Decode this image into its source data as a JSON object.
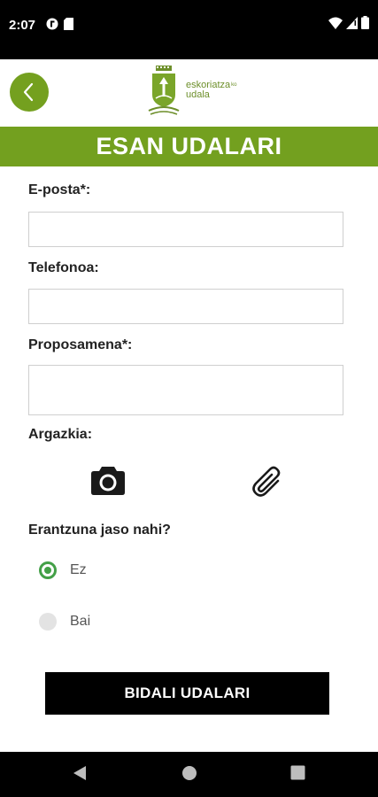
{
  "status_bar": {
    "time": "2:07",
    "icons": [
      "app-notification-icon",
      "sd-card-icon",
      "wifi-icon",
      "signal-icon",
      "battery-icon"
    ]
  },
  "header": {
    "logo_main": "eskoriatza",
    "logo_suffix": "ko",
    "logo_sub": "udala",
    "brand_color": "#73a01f"
  },
  "page": {
    "title": "ESAN UDALARI"
  },
  "form": {
    "email_label": "E-posta*:",
    "email_value": "",
    "phone_label": "Telefonoa:",
    "phone_value": "",
    "proposal_label": "Proposamena*:",
    "proposal_value": "",
    "photo_label": "Argazkia:",
    "photo_actions": [
      "camera-icon",
      "paperclip-icon"
    ],
    "answer_question": "Erantzuna jaso nahi?",
    "answer_options": [
      {
        "label": "Ez",
        "selected": true
      },
      {
        "label": "Bai",
        "selected": false
      }
    ],
    "submit_label": "BIDALI UDALARI"
  },
  "nav_bar": {
    "buttons": [
      "back-triangle-icon",
      "home-circle-icon",
      "recents-square-icon"
    ]
  }
}
